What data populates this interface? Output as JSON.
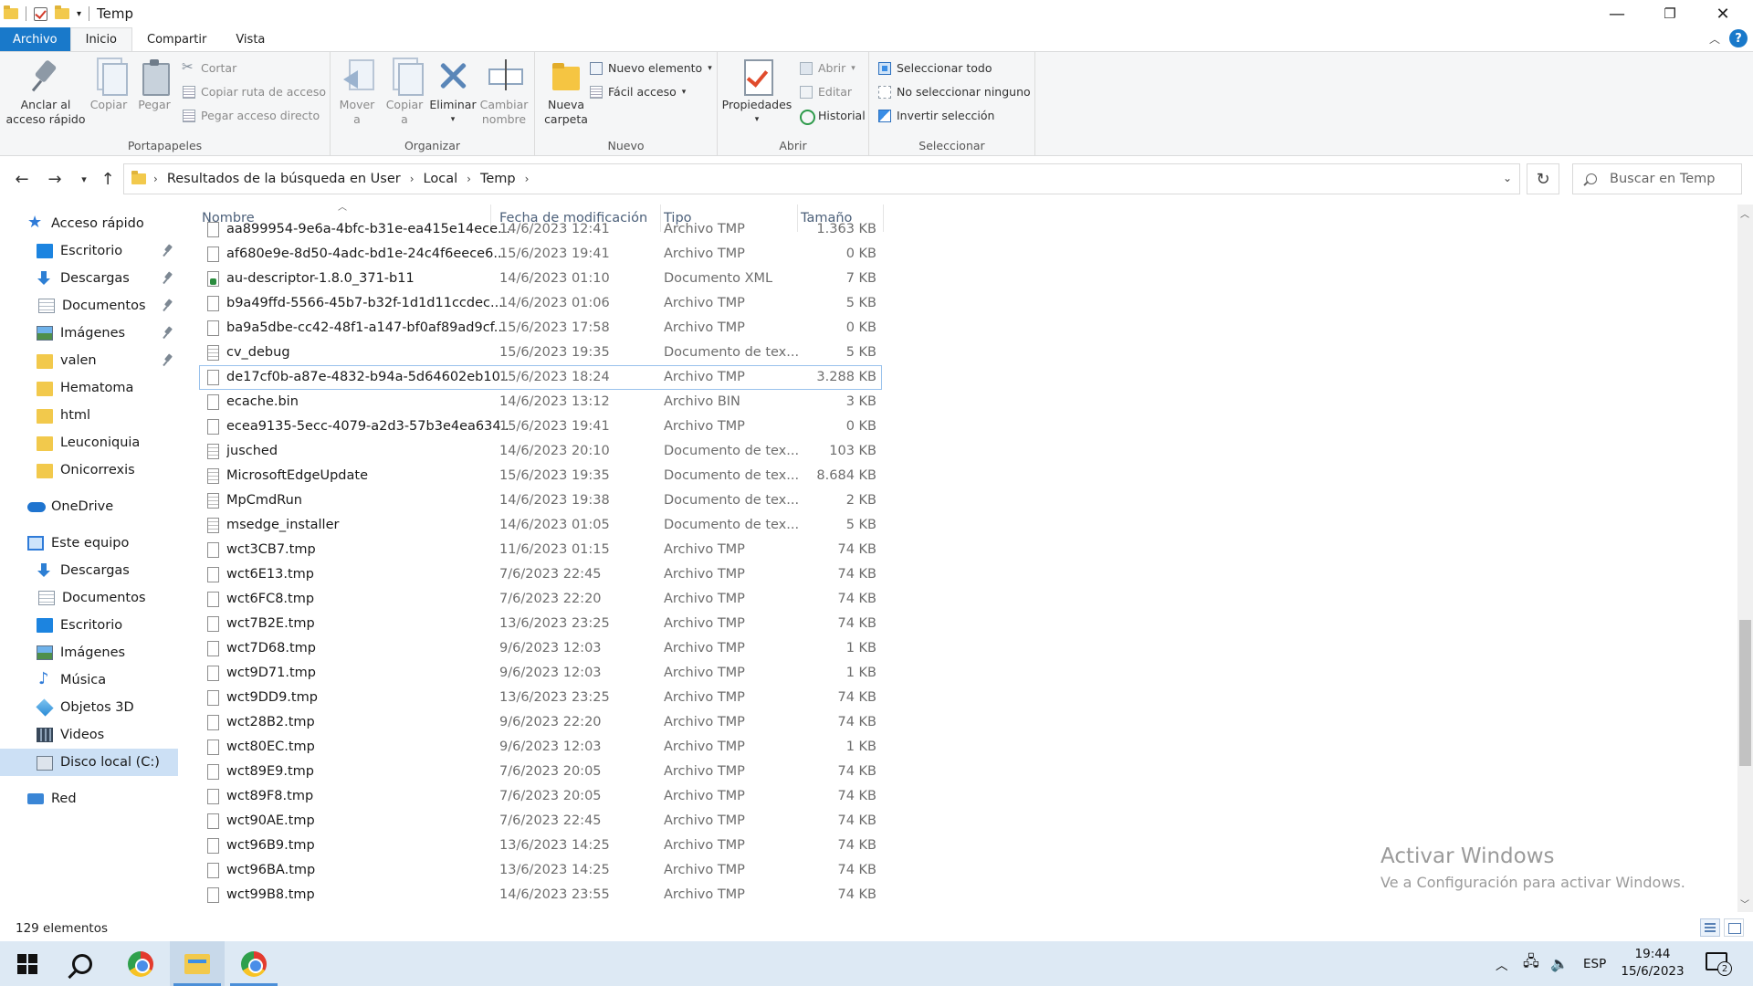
{
  "window": {
    "title": "Temp",
    "minimize": "—",
    "maximize": "❐",
    "close": "✕"
  },
  "ribbon_tabs": [
    "Archivo",
    "Inicio",
    "Compartir",
    "Vista"
  ],
  "ribbon": {
    "portapapeles": {
      "label": "Portapapeles",
      "pin": "Anclar al\nacceso rápido",
      "pin_line1": "Anclar al",
      "pin_line2": "acceso rápido",
      "copy": "Copiar",
      "paste": "Pegar",
      "cut": "Cortar",
      "copy_path": "Copiar ruta de acceso",
      "paste_shortcut": "Pegar acceso directo"
    },
    "organizar": {
      "label": "Organizar",
      "move_line1": "Mover",
      "move_line2": "a",
      "copy_line1": "Copiar",
      "copy_line2": "a",
      "delete": "Eliminar",
      "rename_line1": "Cambiar",
      "rename_line2": "nombre"
    },
    "nuevo": {
      "label": "Nuevo",
      "new_folder_line1": "Nueva",
      "new_folder_line2": "carpeta",
      "new_item": "Nuevo elemento",
      "easy_access": "Fácil acceso"
    },
    "abrir": {
      "label": "Abrir",
      "properties": "Propiedades",
      "open": "Abrir",
      "edit": "Editar",
      "history": "Historial"
    },
    "seleccionar": {
      "label": "Seleccionar",
      "select_all": "Seleccionar todo",
      "select_none": "No seleccionar ninguno",
      "invert": "Invertir selección"
    }
  },
  "address": {
    "crumbs": [
      "Resultados de la búsqueda en User",
      "Local",
      "Temp"
    ],
    "search_placeholder": "Buscar en Temp"
  },
  "sidebar": {
    "items": [
      {
        "label": "Acceso rápido",
        "icon": "star-icon",
        "indent": 0,
        "pinned": false
      },
      {
        "label": "Escritorio",
        "icon": "desktop-icon",
        "indent": 1,
        "pinned": true
      },
      {
        "label": "Descargas",
        "icon": "download-icon",
        "indent": 1,
        "pinned": true
      },
      {
        "label": "Documentos",
        "icon": "document-icon",
        "indent": 1,
        "pinned": true
      },
      {
        "label": "Imágenes",
        "icon": "image-icon",
        "indent": 1,
        "pinned": true
      },
      {
        "label": "valen",
        "icon": "folder-icon",
        "indent": 1,
        "pinned": true
      },
      {
        "label": "Hematoma",
        "icon": "folder-icon",
        "indent": 1,
        "pinned": false
      },
      {
        "label": "html",
        "icon": "folder-icon",
        "indent": 1,
        "pinned": false
      },
      {
        "label": "Leuconiquia",
        "icon": "folder-icon",
        "indent": 1,
        "pinned": false
      },
      {
        "label": "Onicorrexis",
        "icon": "folder-icon",
        "indent": 1,
        "pinned": false
      },
      {
        "label": "OneDrive",
        "icon": "onedrive-icon",
        "indent": 0,
        "pinned": false
      },
      {
        "label": "Este equipo",
        "icon": "pc-icon",
        "indent": 0,
        "pinned": false
      },
      {
        "label": "Descargas",
        "icon": "download-icon",
        "indent": 1,
        "pinned": false
      },
      {
        "label": "Documentos",
        "icon": "document-icon",
        "indent": 1,
        "pinned": false
      },
      {
        "label": "Escritorio",
        "icon": "desktop-icon",
        "indent": 1,
        "pinned": false
      },
      {
        "label": "Imágenes",
        "icon": "image-icon",
        "indent": 1,
        "pinned": false
      },
      {
        "label": "Música",
        "icon": "music-icon",
        "indent": 1,
        "pinned": false
      },
      {
        "label": "Objetos 3D",
        "icon": "objects-3d-icon",
        "indent": 1,
        "pinned": false
      },
      {
        "label": "Videos",
        "icon": "video-icon",
        "indent": 1,
        "pinned": false
      },
      {
        "label": "Disco local (C:)",
        "icon": "disk-icon",
        "indent": 1,
        "pinned": false,
        "selected": true
      },
      {
        "label": "Red",
        "icon": "network-icon",
        "indent": 0,
        "pinned": false
      }
    ]
  },
  "columns": {
    "name": "Nombre",
    "date": "Fecha de modificación",
    "type": "Tipo",
    "size": "Tamaño"
  },
  "files": [
    {
      "name": "aa899954-9e6a-4bfc-b31e-ea415e14ece...",
      "date": "14/6/2023 12:41",
      "type": "Archivo TMP",
      "size": "1.363 KB",
      "icon": "file"
    },
    {
      "name": "af680e9e-8d50-4adc-bd1e-24c4f6eece6...",
      "date": "15/6/2023 19:41",
      "type": "Archivo TMP",
      "size": "0 KB",
      "icon": "file"
    },
    {
      "name": "au-descriptor-1.8.0_371-b11",
      "date": "14/6/2023 01:10",
      "type": "Documento XML",
      "size": "7 KB",
      "icon": "xml"
    },
    {
      "name": "b9a49ffd-5566-45b7-b32f-1d1d11ccdec...",
      "date": "14/6/2023 01:06",
      "type": "Archivo TMP",
      "size": "5 KB",
      "icon": "file"
    },
    {
      "name": "ba9a5dbe-cc42-48f1-a147-bf0af89ad9cf...",
      "date": "15/6/2023 17:58",
      "type": "Archivo TMP",
      "size": "0 KB",
      "icon": "file"
    },
    {
      "name": "cv_debug",
      "date": "15/6/2023 19:35",
      "type": "Documento de tex...",
      "size": "5 KB",
      "icon": "txt"
    },
    {
      "name": "de17cf0b-a87e-4832-b94a-5d64602eb10...",
      "date": "15/6/2023 18:24",
      "type": "Archivo TMP",
      "size": "3.288 KB",
      "icon": "file",
      "focused": true
    },
    {
      "name": "ecache.bin",
      "date": "14/6/2023 13:12",
      "type": "Archivo BIN",
      "size": "3 KB",
      "icon": "file"
    },
    {
      "name": "ecea9135-5ecc-4079-a2d3-57b3e4ea634...",
      "date": "15/6/2023 19:41",
      "type": "Archivo TMP",
      "size": "0 KB",
      "icon": "file"
    },
    {
      "name": "jusched",
      "date": "14/6/2023 20:10",
      "type": "Documento de tex...",
      "size": "103 KB",
      "icon": "txt"
    },
    {
      "name": "MicrosoftEdgeUpdate",
      "date": "15/6/2023 19:35",
      "type": "Documento de tex...",
      "size": "8.684 KB",
      "icon": "txt"
    },
    {
      "name": "MpCmdRun",
      "date": "14/6/2023 19:38",
      "type": "Documento de tex...",
      "size": "2 KB",
      "icon": "txt"
    },
    {
      "name": "msedge_installer",
      "date": "14/6/2023 01:05",
      "type": "Documento de tex...",
      "size": "5 KB",
      "icon": "txt"
    },
    {
      "name": "wct3CB7.tmp",
      "date": "11/6/2023 01:15",
      "type": "Archivo TMP",
      "size": "74 KB",
      "icon": "file"
    },
    {
      "name": "wct6E13.tmp",
      "date": "7/6/2023 22:45",
      "type": "Archivo TMP",
      "size": "74 KB",
      "icon": "file"
    },
    {
      "name": "wct6FC8.tmp",
      "date": "7/6/2023 22:20",
      "type": "Archivo TMP",
      "size": "74 KB",
      "icon": "file"
    },
    {
      "name": "wct7B2E.tmp",
      "date": "13/6/2023 23:25",
      "type": "Archivo TMP",
      "size": "74 KB",
      "icon": "file"
    },
    {
      "name": "wct7D68.tmp",
      "date": "9/6/2023 12:03",
      "type": "Archivo TMP",
      "size": "1 KB",
      "icon": "file"
    },
    {
      "name": "wct9D71.tmp",
      "date": "9/6/2023 12:03",
      "type": "Archivo TMP",
      "size": "1 KB",
      "icon": "file"
    },
    {
      "name": "wct9DD9.tmp",
      "date": "13/6/2023 23:25",
      "type": "Archivo TMP",
      "size": "74 KB",
      "icon": "file"
    },
    {
      "name": "wct28B2.tmp",
      "date": "9/6/2023 22:20",
      "type": "Archivo TMP",
      "size": "74 KB",
      "icon": "file"
    },
    {
      "name": "wct80EC.tmp",
      "date": "9/6/2023 12:03",
      "type": "Archivo TMP",
      "size": "1 KB",
      "icon": "file"
    },
    {
      "name": "wct89E9.tmp",
      "date": "7/6/2023 20:05",
      "type": "Archivo TMP",
      "size": "74 KB",
      "icon": "file"
    },
    {
      "name": "wct89F8.tmp",
      "date": "7/6/2023 20:05",
      "type": "Archivo TMP",
      "size": "74 KB",
      "icon": "file"
    },
    {
      "name": "wct90AE.tmp",
      "date": "7/6/2023 22:45",
      "type": "Archivo TMP",
      "size": "74 KB",
      "icon": "file"
    },
    {
      "name": "wct96B9.tmp",
      "date": "13/6/2023 14:25",
      "type": "Archivo TMP",
      "size": "74 KB",
      "icon": "file"
    },
    {
      "name": "wct96BA.tmp",
      "date": "13/6/2023 14:25",
      "type": "Archivo TMP",
      "size": "74 KB",
      "icon": "file"
    },
    {
      "name": "wct99B8.tmp",
      "date": "14/6/2023 23:55",
      "type": "Archivo TMP",
      "size": "74 KB",
      "icon": "file"
    }
  ],
  "status": {
    "count": "129 elementos"
  },
  "watermark": {
    "line1": "Activar Windows",
    "line2": "Ve a Configuración para activar Windows."
  },
  "taskbar": {
    "language": "ESP",
    "time": "19:44",
    "date": "15/6/2023",
    "notifications": "2"
  },
  "colors": {
    "accent": "#1979ca",
    "selection": "#cce0f5",
    "taskbar": "#dde9f4"
  }
}
